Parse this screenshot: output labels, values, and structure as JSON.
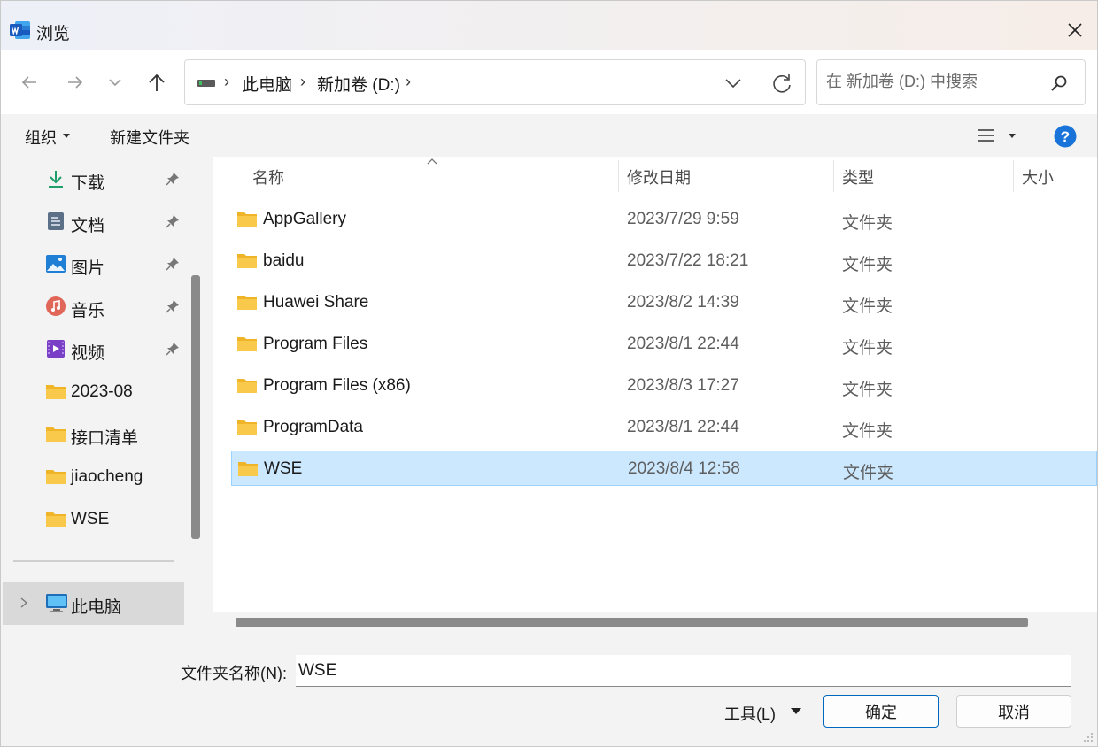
{
  "window": {
    "title": "浏览",
    "app_icon": "word-icon",
    "close_icon": "close-icon"
  },
  "navigation": {
    "back_icon": "arrow-left-icon",
    "forward_icon": "arrow-right-icon",
    "recent_icon": "chevron-down-icon",
    "up_icon": "arrow-up-icon",
    "breadcrumb": [
      "此电脑",
      "新加卷 (D:)"
    ],
    "search_placeholder": "在 新加卷 (D:) 中搜索"
  },
  "toolbar": {
    "organize_label": "组织",
    "new_folder_label": "新建文件夹",
    "view_icon": "list-view-icon",
    "help_icon": "help-icon"
  },
  "sidebar": {
    "quick_access": [
      {
        "label": "下载",
        "icon": "download-icon",
        "pinned": true
      },
      {
        "label": "文档",
        "icon": "document-icon",
        "pinned": true
      },
      {
        "label": "图片",
        "icon": "picture-icon",
        "pinned": true
      },
      {
        "label": "音乐",
        "icon": "music-icon",
        "pinned": true
      },
      {
        "label": "视频",
        "icon": "video-icon",
        "pinned": true
      },
      {
        "label": "2023-08",
        "icon": "folder-icon",
        "pinned": false
      },
      {
        "label": "接口清单",
        "icon": "folder-icon",
        "pinned": false
      },
      {
        "label": "jiaocheng",
        "icon": "folder-icon",
        "pinned": false
      },
      {
        "label": "WSE",
        "icon": "folder-icon",
        "pinned": false
      }
    ],
    "this_pc_label": "此电脑"
  },
  "file_list": {
    "columns": {
      "name": "名称",
      "date": "修改日期",
      "type": "类型",
      "size": "大小"
    },
    "rows": [
      {
        "name": "AppGallery",
        "date": "2023/7/29 9:59",
        "type": "文件夹",
        "selected": false
      },
      {
        "name": "baidu",
        "date": "2023/7/22 18:21",
        "type": "文件夹",
        "selected": false
      },
      {
        "name": "Huawei Share",
        "date": "2023/8/2 14:39",
        "type": "文件夹",
        "selected": false
      },
      {
        "name": "Program Files",
        "date": "2023/8/1 22:44",
        "type": "文件夹",
        "selected": false
      },
      {
        "name": "Program Files (x86)",
        "date": "2023/8/3 17:27",
        "type": "文件夹",
        "selected": false
      },
      {
        "name": "ProgramData",
        "date": "2023/8/1 22:44",
        "type": "文件夹",
        "selected": false
      },
      {
        "name": "WSE",
        "date": "2023/8/4 12:58",
        "type": "文件夹",
        "selected": true
      }
    ]
  },
  "footer": {
    "folder_name_label": "文件夹名称(N):",
    "folder_name_value": "WSE",
    "tools_label": "工具(L)",
    "ok_label": "确定",
    "cancel_label": "取消"
  },
  "colors": {
    "selection_bg": "#cce8ff",
    "selection_border": "#99d1ff",
    "primary_border": "#0067c0",
    "help_blue": "#1a73d9",
    "folder_yellow": "#f8c94b"
  }
}
